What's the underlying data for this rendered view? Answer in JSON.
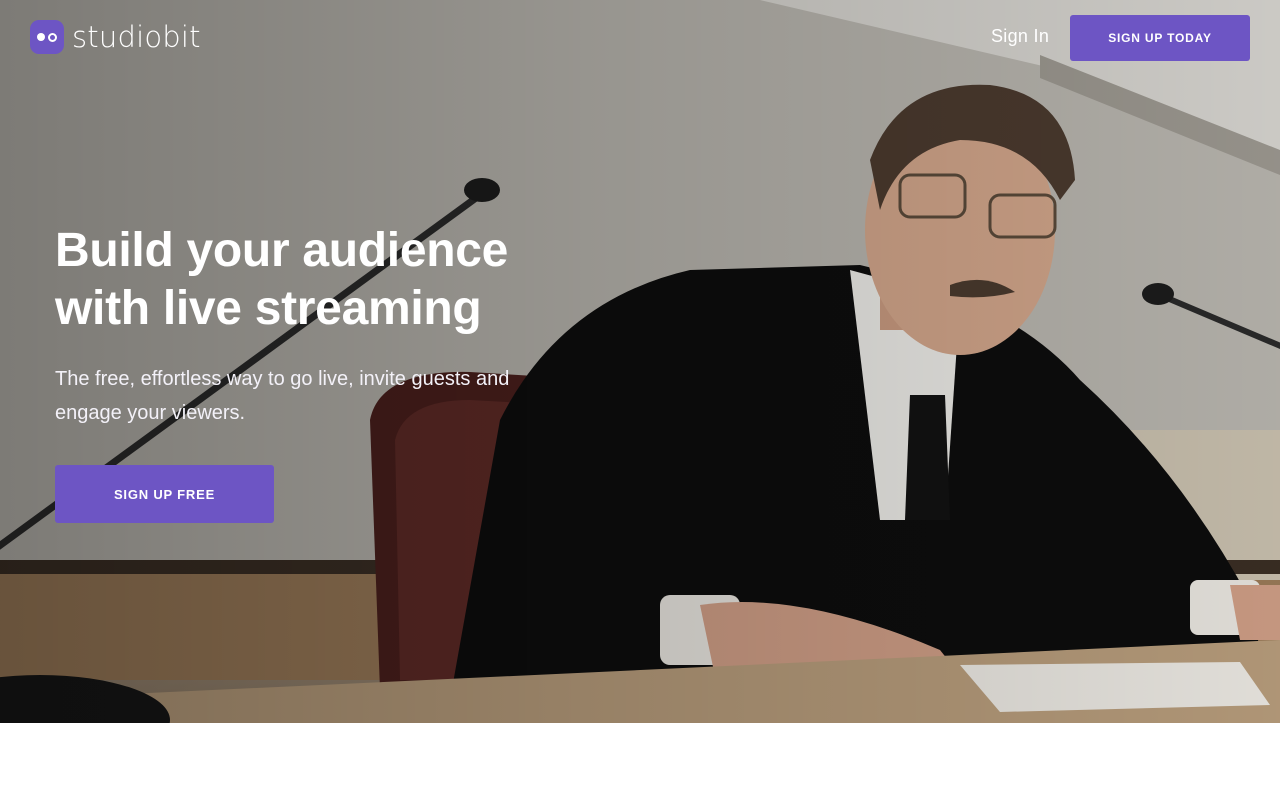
{
  "brand": {
    "name": "studiobit",
    "accent": "#6d55c4"
  },
  "nav": {
    "sign_in": "Sign In",
    "cta": "SIGN UP TODAY"
  },
  "hero": {
    "headline": "Build your audience with live streaming",
    "subhead": "The free, effortless way to go live, invite guests and engage your viewers.",
    "cta": "SIGN UP FREE",
    "background": "speaker-at-conference-desk-photo"
  }
}
